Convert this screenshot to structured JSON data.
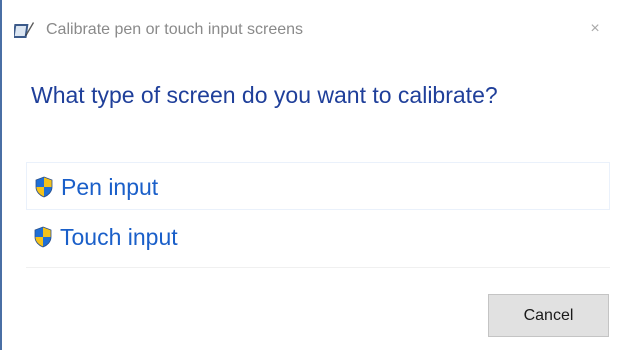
{
  "window": {
    "title": "Calibrate pen or touch input screens",
    "close_glyph": "×"
  },
  "main": {
    "heading": "What type of screen do you want to calibrate?",
    "options": [
      {
        "label": "Pen input",
        "icon": "uac-shield-icon"
      },
      {
        "label": "Touch input",
        "icon": "uac-shield-icon"
      }
    ]
  },
  "footer": {
    "cancel_label": "Cancel"
  },
  "colors": {
    "heading": "#1f3f9a",
    "link": "#1a5fc9",
    "title_text": "#8a8a8a",
    "button_bg": "#e1e1e1",
    "shield_blue": "#1f6fd6",
    "shield_yellow": "#f4c21b"
  }
}
